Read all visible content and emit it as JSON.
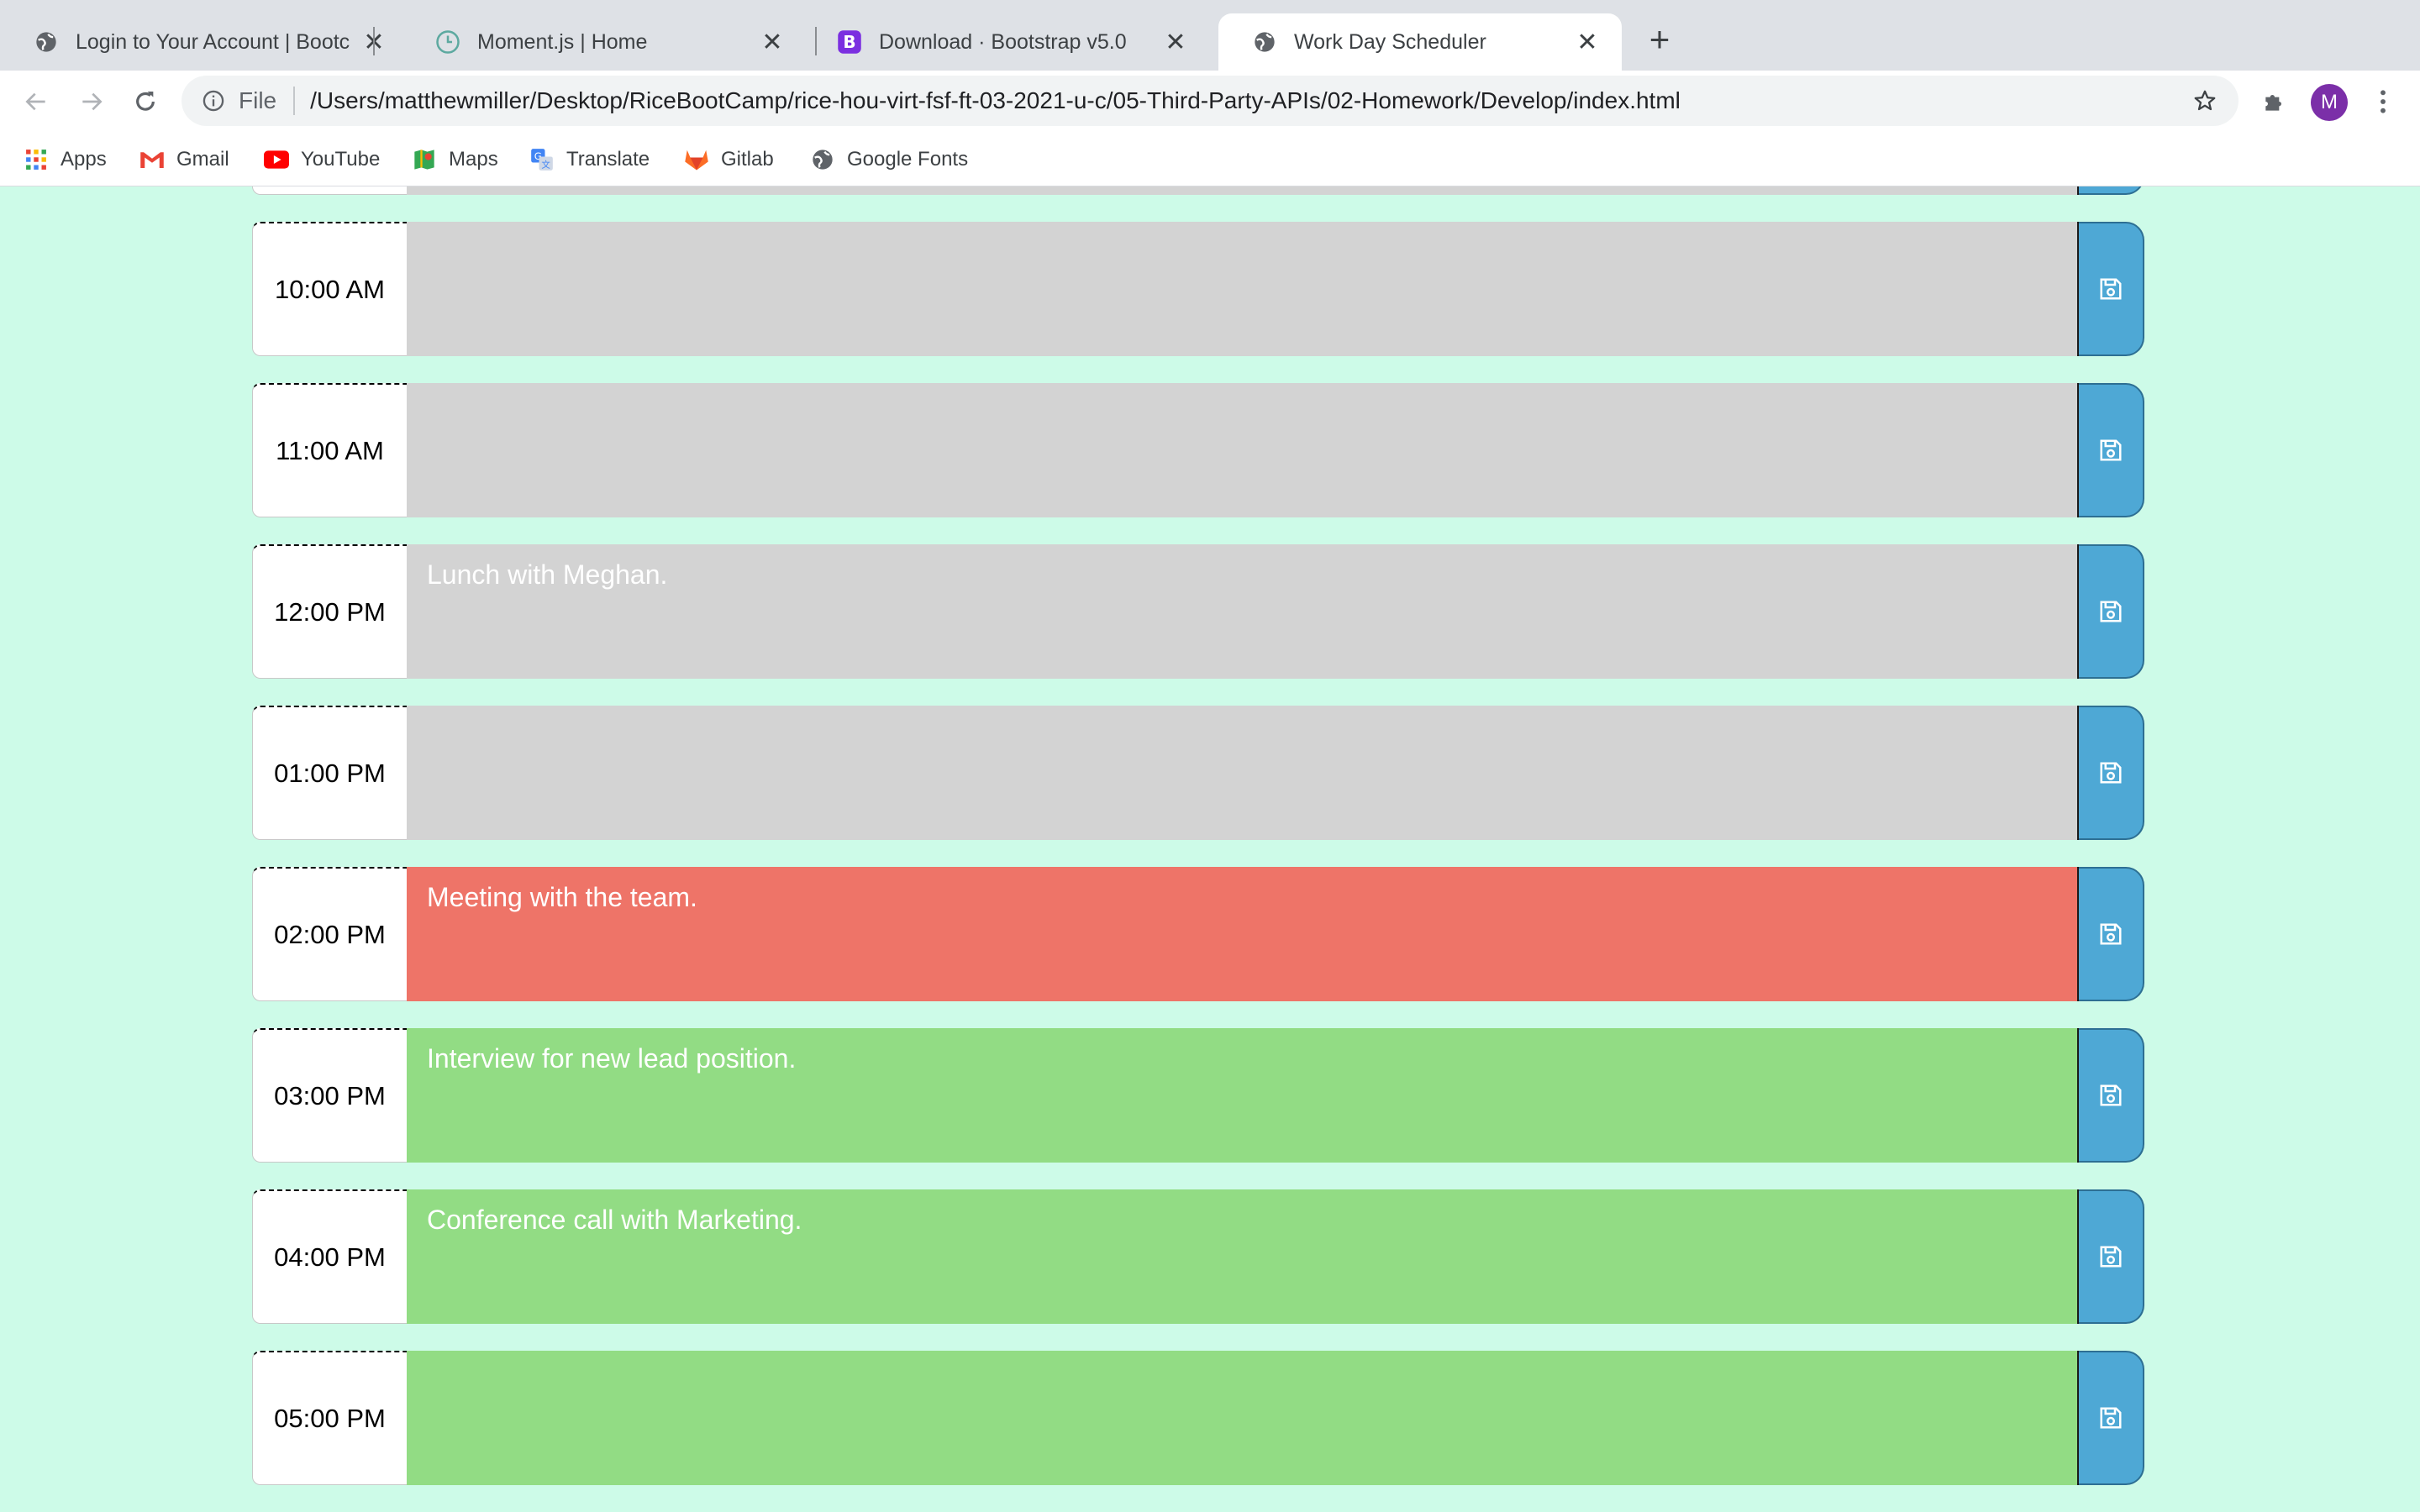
{
  "browser": {
    "tabs": [
      {
        "title": "Login to Your Account | Bootca",
        "icon": "globe-icon"
      },
      {
        "title": "Moment.js | Home",
        "icon": "clock-icon"
      },
      {
        "title": "Download · Bootstrap v5.0",
        "icon": "bootstrap-icon"
      },
      {
        "title": "Work Day Scheduler",
        "icon": "globe-icon"
      }
    ],
    "new_tab_label": "+",
    "omnibox": {
      "scheme": "File",
      "url": "/Users/matthewmiller/Desktop/RiceBootCamp/rice-hou-virt-fsf-ft-03-2021-u-c/05-Third-Party-APIs/02-Homework/Develop/index.html"
    },
    "avatar_letter": "M",
    "bookmarks": [
      {
        "label": "Apps",
        "icon": "apps-grid-icon"
      },
      {
        "label": "Gmail",
        "icon": "gmail-icon"
      },
      {
        "label": "YouTube",
        "icon": "youtube-icon"
      },
      {
        "label": "Maps",
        "icon": "maps-icon"
      },
      {
        "label": "Translate",
        "icon": "translate-icon"
      },
      {
        "label": "Gitlab",
        "icon": "gitlab-icon"
      },
      {
        "label": "Google Fonts",
        "icon": "globe-icon"
      }
    ]
  },
  "colors": {
    "page_bg": "#cdfbe8",
    "past": "#d3d3d3",
    "present": "#ee7468",
    "future": "#92dc84",
    "save_button": "#4ea8d5"
  },
  "scheduler": {
    "rows": [
      {
        "hour": "10:00 AM",
        "text": "",
        "state": "past"
      },
      {
        "hour": "11:00 AM",
        "text": "",
        "state": "past"
      },
      {
        "hour": "12:00 PM",
        "text": "Lunch with Meghan.",
        "state": "past"
      },
      {
        "hour": "01:00 PM",
        "text": "",
        "state": "past"
      },
      {
        "hour": "02:00 PM",
        "text": "Meeting with the team.",
        "state": "present"
      },
      {
        "hour": "03:00 PM",
        "text": "Interview for new lead position.",
        "state": "future"
      },
      {
        "hour": "04:00 PM",
        "text": "Conference call with Marketing.",
        "state": "future"
      },
      {
        "hour": "05:00 PM",
        "text": "",
        "state": "future"
      }
    ],
    "save_icon": "floppy-disk-icon"
  }
}
